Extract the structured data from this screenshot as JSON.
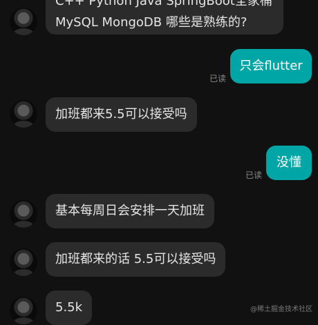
{
  "messages": {
    "m1_line1": "C++ Python Java SpringBoot全家桶",
    "m1_line2": "MySQL MongoDB 哪些是熟练的?",
    "m2": "只会flutter",
    "m2_read": "已读",
    "m3": "加班都来5.5可以接受吗",
    "m4": "没懂",
    "m4_read": "已读",
    "m5": "基本每周日会安排一天加班",
    "m6": "加班都来的话  5.5可以接受吗",
    "m7": "5.5k"
  },
  "watermark": "@稀土掘金技术社区"
}
